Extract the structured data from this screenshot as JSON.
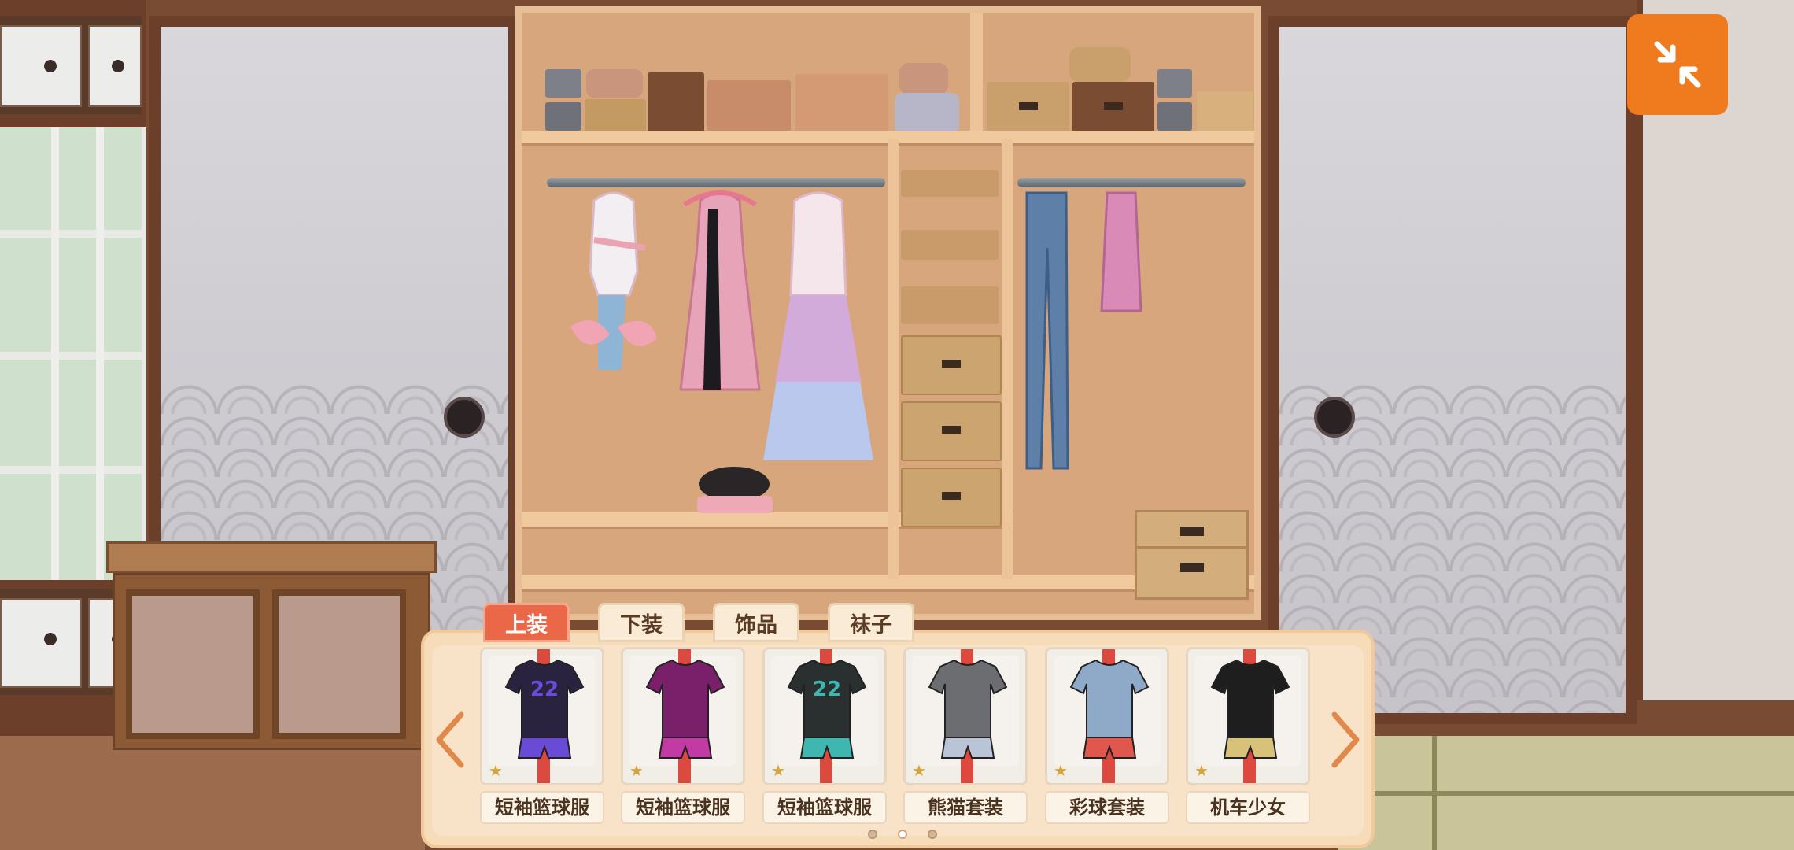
{
  "header": {
    "exit_button_icon": "shrink-arrows-icon"
  },
  "tabs": [
    {
      "label": "上装",
      "active": true
    },
    {
      "label": "下装",
      "active": false
    },
    {
      "label": "饰品",
      "active": false
    },
    {
      "label": "袜子",
      "active": false
    }
  ],
  "items": [
    {
      "label": "短袖篮球服",
      "number": "22",
      "shirt_color": "#2a2340",
      "accent": "#6a4bd6"
    },
    {
      "label": "短袖篮球服",
      "number": "",
      "shirt_color": "#7a1f6a",
      "accent": "#c23aa3"
    },
    {
      "label": "短袖篮球服",
      "number": "22",
      "shirt_color": "#2a2f30",
      "accent": "#3fb7b0"
    },
    {
      "label": "熊猫套装",
      "number": "",
      "shirt_color": "#6b6d70",
      "accent": "#b9c4d6"
    },
    {
      "label": "彩球套装",
      "number": "",
      "shirt_color": "#8fa9c8",
      "accent": "#e0584d"
    },
    {
      "label": "机车少女",
      "number": "",
      "shirt_color": "#1e1e1e",
      "accent": "#d8c27a"
    }
  ],
  "pagination": {
    "total": 3,
    "current": 2
  },
  "colors": {
    "accent": "#f07a1e",
    "tab_active": "#ea6848",
    "ribbon": "#dc4a3f"
  }
}
